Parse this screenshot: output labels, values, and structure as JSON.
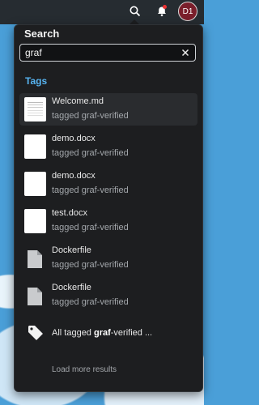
{
  "topbar": {
    "search_icon": "search-icon",
    "bell_icon": "bell-icon",
    "avatar_initials": "D1"
  },
  "search": {
    "title": "Search",
    "query": "graf",
    "clear_icon": "close-icon"
  },
  "tags_section": {
    "title": "Tags"
  },
  "results": [
    {
      "name": "Welcome.md",
      "subtitle": "tagged graf-verified",
      "thumb": "doc-thumbnail"
    },
    {
      "name": "demo.docx",
      "subtitle": "tagged graf-verified",
      "thumb": "blank-thumbnail"
    },
    {
      "name": "demo.docx",
      "subtitle": "tagged graf-verified",
      "thumb": "blank-thumbnail"
    },
    {
      "name": "test.docx",
      "subtitle": "tagged graf-verified",
      "thumb": "blank-thumbnail"
    },
    {
      "name": "Dockerfile",
      "subtitle": "tagged graf-verified",
      "thumb": "file-icon"
    },
    {
      "name": "Dockerfile",
      "subtitle": "tagged graf-verified",
      "thumb": "file-icon"
    }
  ],
  "all_tagged": {
    "prefix": "All tagged ",
    "term": "graf",
    "suffix": "-verified ...",
    "icon": "tag-icon"
  },
  "load_more": "Load more results",
  "colors": {
    "panel_bg": "#1d1e20",
    "accent": "#57b4f1",
    "avatar_bg": "#7a1e2b"
  }
}
